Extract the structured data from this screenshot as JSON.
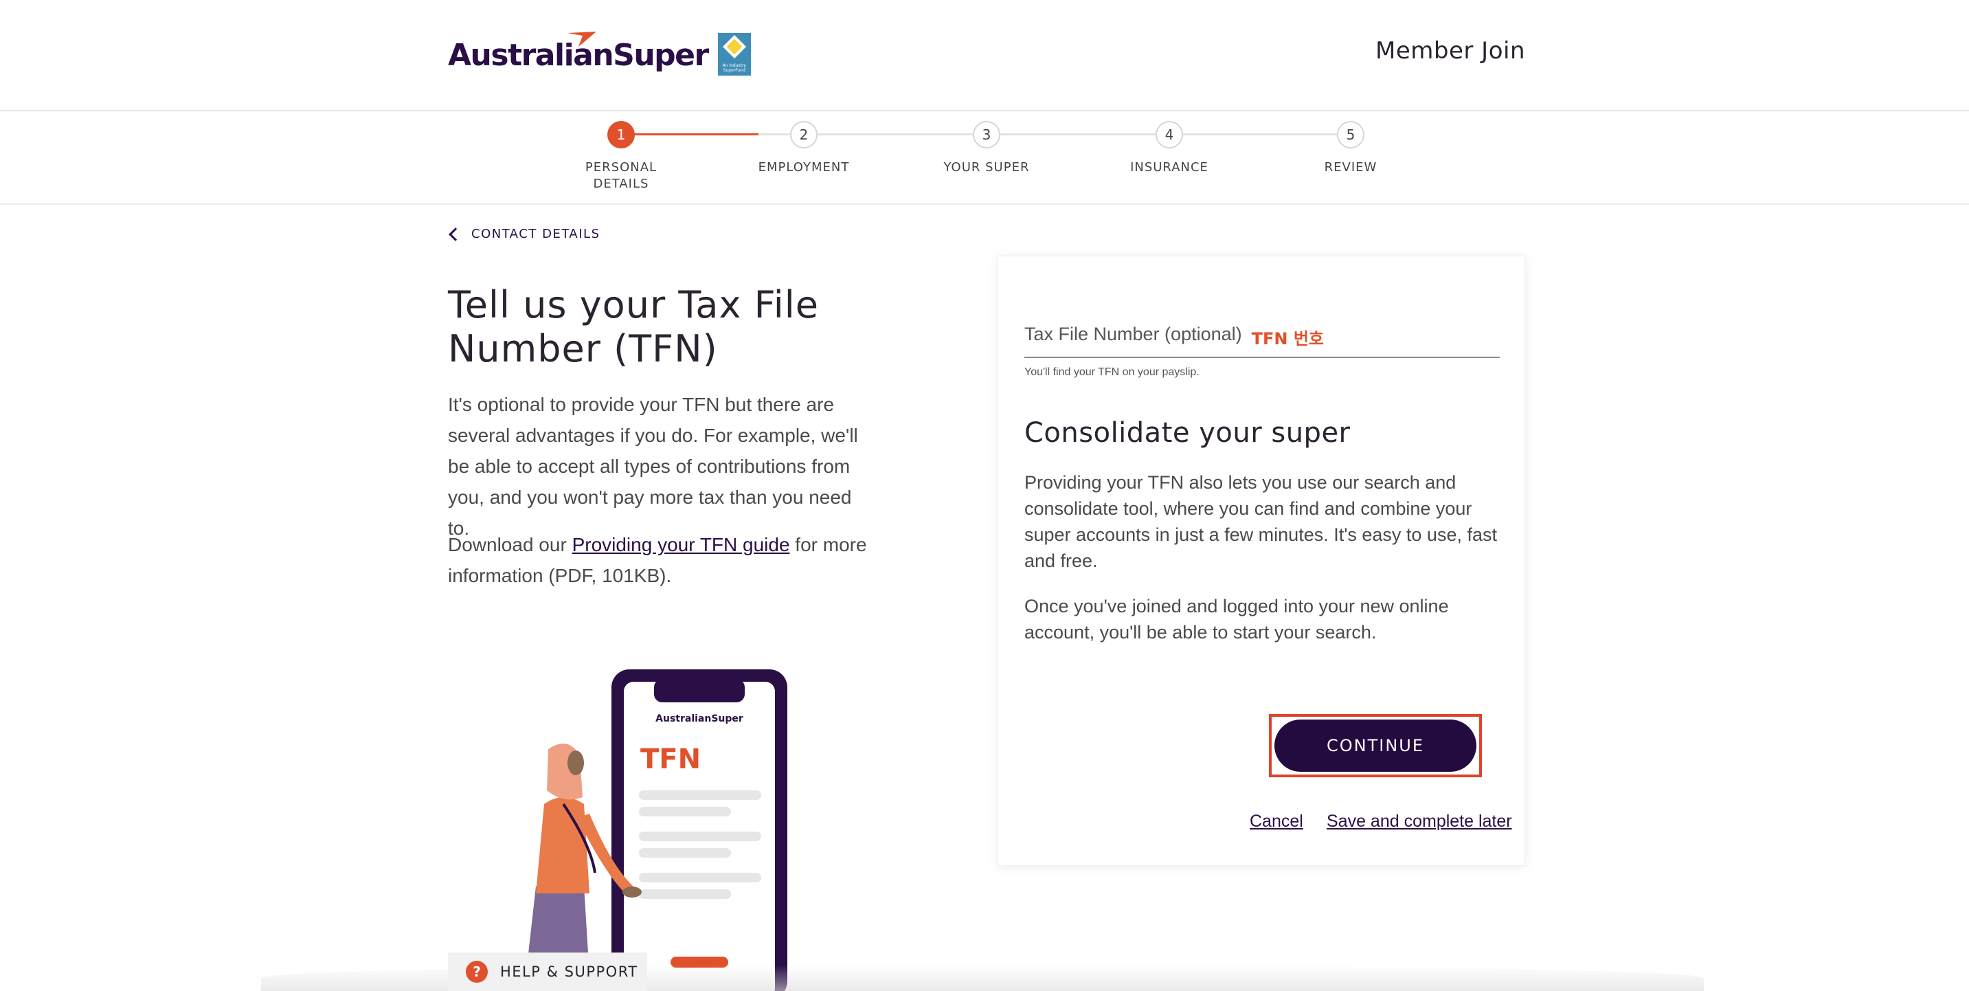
{
  "header": {
    "logo_text": "AustralianSuper",
    "logo_badge_text": "An Industry SuperFund",
    "member_join": "Member Join"
  },
  "stepper": {
    "steps": [
      {
        "number": "1",
        "label_line1": "PERSONAL",
        "label_line2": "DETAILS",
        "active": true
      },
      {
        "number": "2",
        "label_line1": "EMPLOYMENT",
        "label_line2": "",
        "active": false
      },
      {
        "number": "3",
        "label_line1": "YOUR SUPER",
        "label_line2": "",
        "active": false
      },
      {
        "number": "4",
        "label_line1": "INSURANCE",
        "label_line2": "",
        "active": false
      },
      {
        "number": "5",
        "label_line1": "REVIEW",
        "label_line2": "",
        "active": false
      }
    ]
  },
  "nav": {
    "back_label": "CONTACT DETAILS"
  },
  "main": {
    "title": "Tell us your Tax File Number (TFN)",
    "intro": "It's optional to provide your TFN but there are several advantages if you do. For example, we'll be able to accept all types of contributions from you, and you won't pay more tax than you need to.",
    "download_prefix": "Download our ",
    "download_link": "Providing your TFN guide",
    "download_suffix": " for more information (PDF, 101KB)."
  },
  "illustration": {
    "phone_brand": "AustralianSuper",
    "phone_heading": "TFN"
  },
  "card": {
    "tfn_label": "Tax File Number (optional)",
    "tfn_korean": "TFN 번호",
    "tfn_hint": "You'll find your TFN on your payslip.",
    "title": "Consolidate your super",
    "para1": "Providing your TFN also lets you use our search and consolidate tool, where you can find and combine your super accounts in just a few minutes. It's easy to use, fast and free.",
    "para2": "Once you've joined and logged into your new online account, you'll be able to start your search.",
    "continue_label": "CONTINUE",
    "cancel_label": "Cancel",
    "save_label": "Save and complete later"
  },
  "help": {
    "icon_glyph": "?",
    "label": "HELP & SUPPORT"
  },
  "colors": {
    "brand_purple": "#2a0f47",
    "accent_orange": "#e0512b",
    "highlight_red": "#e0432b"
  }
}
